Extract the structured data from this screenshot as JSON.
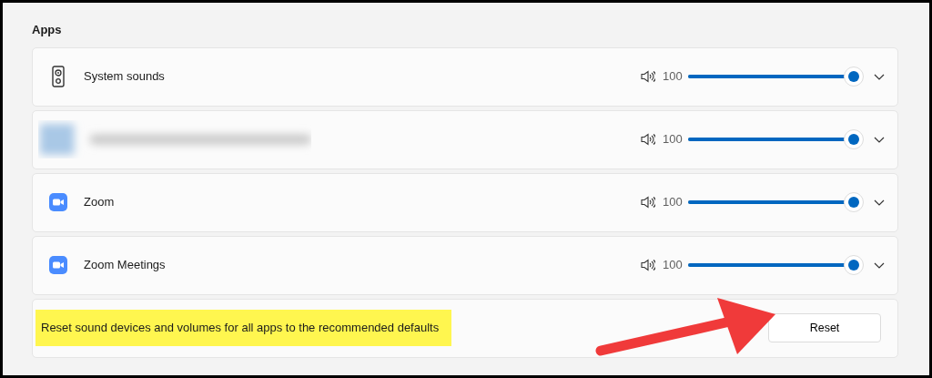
{
  "section_title": "Apps",
  "apps": [
    {
      "kind": "system",
      "name": "System sounds",
      "volume": "100",
      "level": 1
    },
    {
      "kind": "blurred",
      "volume": "100",
      "level": 1
    },
    {
      "kind": "zoom",
      "name": "Zoom",
      "volume": "100",
      "level": 1
    },
    {
      "kind": "zoom",
      "name": "Zoom Meetings",
      "volume": "100",
      "level": 1
    }
  ],
  "reset": {
    "text": "Reset sound devices and volumes for all apps to the recommended defaults",
    "highlighted": true,
    "button": "Reset",
    "pointer_arrow": true
  }
}
